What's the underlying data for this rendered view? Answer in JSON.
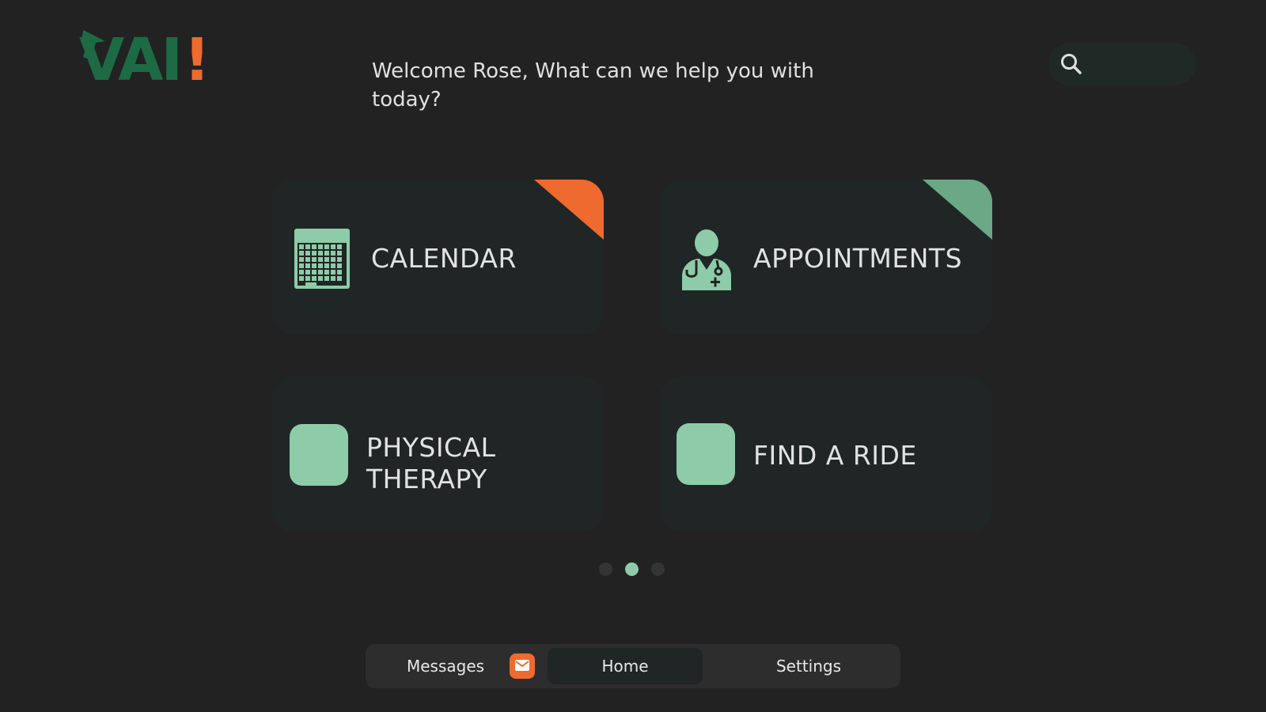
{
  "app": {
    "logo_text": "VAI",
    "logo_bang": "!",
    "brand_green": "#1d6b44",
    "brand_orange": "#ee6a2f",
    "accent_mint": "#8ecba8"
  },
  "header": {
    "greeting": "Welcome Rose, What can we help you with today?",
    "search_icon": "search-icon"
  },
  "cards": [
    {
      "label": "CALENDAR",
      "icon": "calendar-icon",
      "corner_color": "#ee6a2f"
    },
    {
      "label": "APPOINTMENTS",
      "icon": "doctor-icon",
      "corner_color": "#6aa886"
    },
    {
      "label_line1": "PHYSICAL",
      "label_line2": "THERAPY",
      "icon": "placeholder-icon"
    },
    {
      "label": "FIND A RIDE",
      "icon": "placeholder-icon"
    }
  ],
  "pager": {
    "pages": 3,
    "active_index": 1
  },
  "bottom_nav": {
    "messages": "Messages",
    "messages_icon": "mail-icon",
    "home": "Home",
    "settings": "Settings",
    "active": "Home"
  }
}
